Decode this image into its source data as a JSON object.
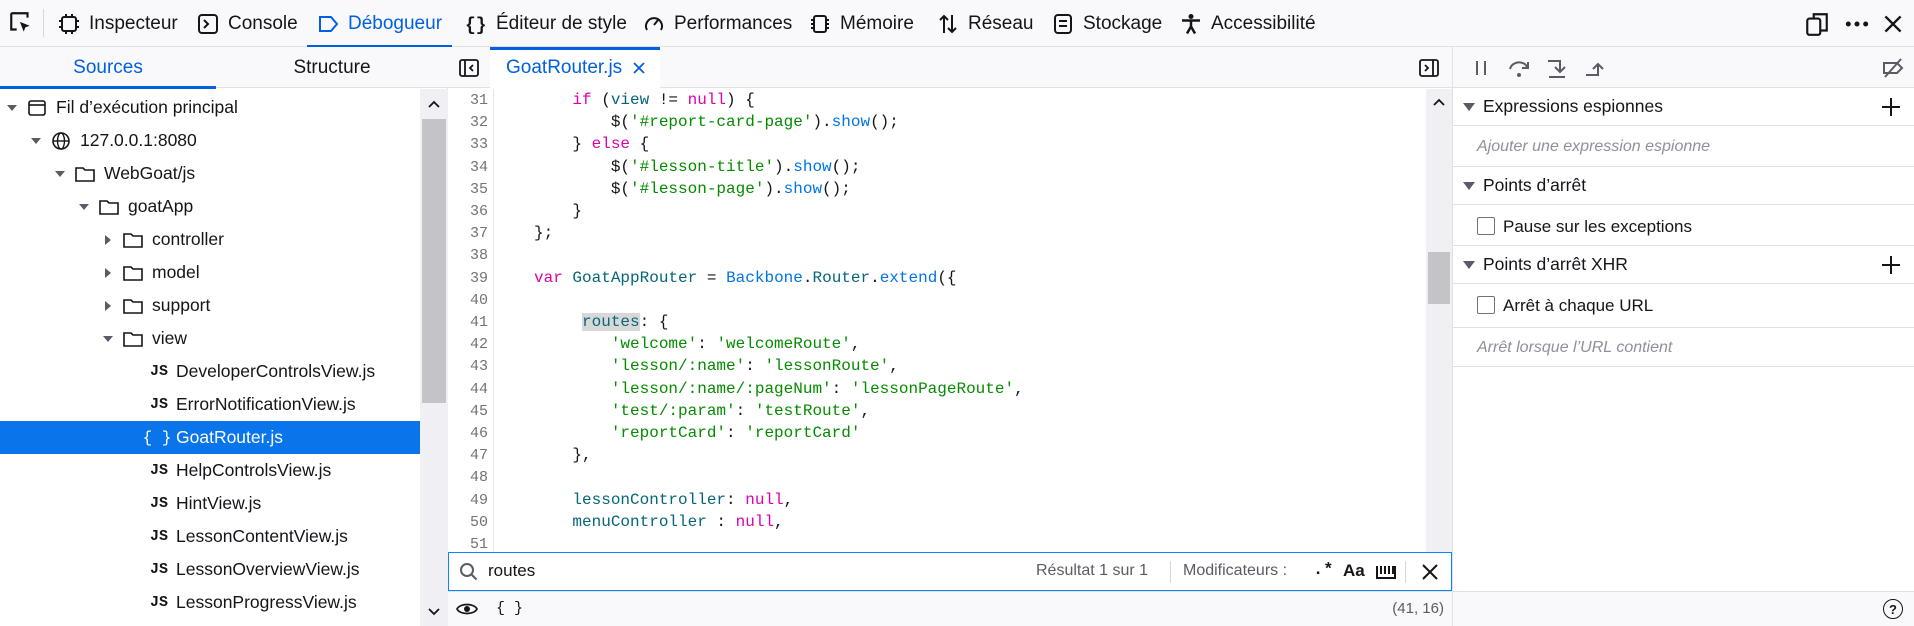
{
  "toolbar": {
    "tabs": [
      {
        "label": "Inspecteur",
        "icon": "inspector-icon"
      },
      {
        "label": "Console",
        "icon": "console-icon"
      },
      {
        "label": "Débogueur",
        "icon": "debugger-icon"
      },
      {
        "label": "Éditeur de style",
        "icon": "style-editor-icon"
      },
      {
        "label": "Performances",
        "icon": "performance-icon"
      },
      {
        "label": "Mémoire",
        "icon": "memory-icon"
      },
      {
        "label": "Réseau",
        "icon": "network-icon"
      },
      {
        "label": "Stockage",
        "icon": "storage-icon"
      },
      {
        "label": "Accessibilité",
        "icon": "accessibility-icon"
      }
    ],
    "active_tab": "Débogueur"
  },
  "sources": {
    "tabs": [
      "Sources",
      "Structure"
    ],
    "tree": [
      {
        "label": "Fil d’exécution principal",
        "kind": "thread",
        "expanded": true
      },
      {
        "label": "127.0.0.1:8080",
        "kind": "globe",
        "expanded": true
      },
      {
        "label": "WebGoat/js",
        "kind": "folder",
        "expanded": true
      },
      {
        "label": "goatApp",
        "kind": "folder",
        "expanded": true
      },
      {
        "label": "controller",
        "kind": "folder",
        "expanded": false
      },
      {
        "label": "model",
        "kind": "folder",
        "expanded": false
      },
      {
        "label": "support",
        "kind": "folder",
        "expanded": false
      },
      {
        "label": "view",
        "kind": "folder",
        "expanded": true
      },
      {
        "label": "DeveloperControlsView.js",
        "kind": "js"
      },
      {
        "label": "ErrorNotificationView.js",
        "kind": "js"
      },
      {
        "label": "GoatRouter.js",
        "kind": "pretty",
        "selected": true
      },
      {
        "label": "HelpControlsView.js",
        "kind": "js"
      },
      {
        "label": "HintView.js",
        "kind": "js"
      },
      {
        "label": "LessonContentView.js",
        "kind": "js"
      },
      {
        "label": "LessonOverviewView.js",
        "kind": "js"
      },
      {
        "label": "LessonProgressView.js",
        "kind": "js"
      }
    ]
  },
  "editor": {
    "tab_label": "GoatRouter.js",
    "line_numbers": [
      "31",
      "32",
      "33",
      "34",
      "35",
      "36",
      "37",
      "38",
      "39",
      "40",
      "41",
      "42",
      "43",
      "44",
      "45",
      "46",
      "47",
      "48",
      "49",
      "50",
      "51"
    ],
    "search": {
      "query": "routes",
      "result": "Résultat 1 sur 1",
      "modifiers_label": "Modificateurs :",
      "regex_label": ".*",
      "case_label": "Aa"
    },
    "footer": {
      "pretty_print": "{ }",
      "cursor": "(41, 16)"
    }
  },
  "right_panel": {
    "watch": {
      "title": "Expressions espionnes",
      "placeholder": "Ajouter une expression espionne"
    },
    "breakpoints": {
      "title": "Points d’arrêt",
      "pause_exceptions": "Pause sur les exceptions"
    },
    "xhr": {
      "title": "Points d’arrêt XHR",
      "any_url": "Arrêt à chaque URL",
      "placeholder": "Arrêt lorsque l’URL contient"
    },
    "help": "?"
  }
}
